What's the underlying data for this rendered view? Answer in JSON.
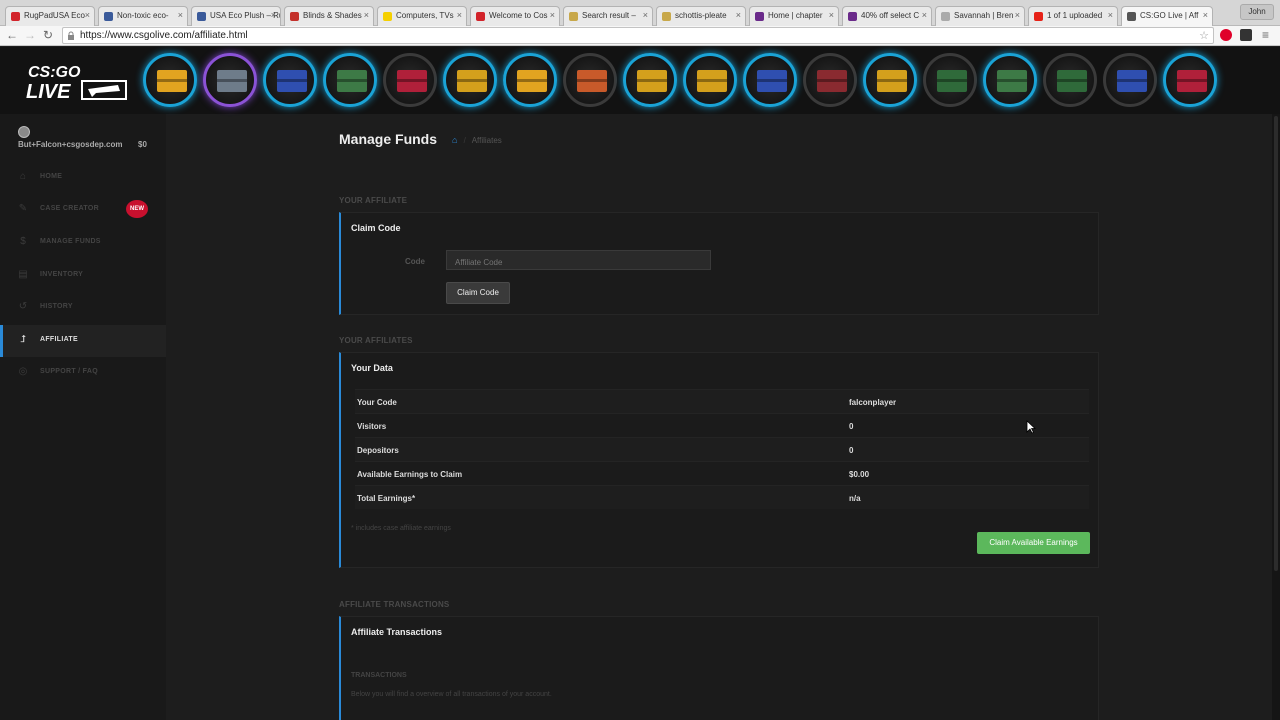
{
  "browser": {
    "tabs": [
      {
        "label": "RugPadUSA Eco",
        "color": "#d2232a"
      },
      {
        "label": "Non-toxic eco-",
        "color": "#3a5a9a"
      },
      {
        "label": "USA Eco Plush – Rug",
        "color": "#3a5a9a"
      },
      {
        "label": "Blinds & Shades",
        "color": "#c4312b"
      },
      {
        "label": "Computers, TVs",
        "color": "#f5d000"
      },
      {
        "label": "Welcome to Cos",
        "color": "#d2232a"
      },
      {
        "label": "Search result – ",
        "color": "#c8a84a"
      },
      {
        "label": "schottis-pleate",
        "color": "#c8a84a"
      },
      {
        "label": "Home | chapter",
        "color": "#6a2a8a"
      },
      {
        "label": "40% off select C",
        "color": "#6a2a8a"
      },
      {
        "label": "Savannah | Bren",
        "color": "#aaaaaa"
      },
      {
        "label": "1 of 1 uploaded",
        "color": "#e62117"
      },
      {
        "label": "CS:GO Live | Aff",
        "color": "#555555"
      }
    ],
    "profile": "John",
    "url": "https://www.csgolive.com/affiliate.html"
  },
  "header": {
    "logo_line1": "CS:GO",
    "logo_line2": "LIVE",
    "cases": [
      {
        "ring": "blue",
        "color": "#e2a420"
      },
      {
        "ring": "purple",
        "color": "#6e7c8a"
      },
      {
        "ring": "blue",
        "color": "#2f4fb0"
      },
      {
        "ring": "blue",
        "color": "#3d7a46"
      },
      {
        "ring": "dim",
        "color": "#b0203a"
      },
      {
        "ring": "blue",
        "color": "#d4a01c"
      },
      {
        "ring": "blue",
        "color": "#e2a420"
      },
      {
        "ring": "dim",
        "color": "#c85a2a"
      },
      {
        "ring": "blue",
        "color": "#d4a01c"
      },
      {
        "ring": "blue",
        "color": "#d4a01c"
      },
      {
        "ring": "blue",
        "color": "#2f4fb0"
      },
      {
        "ring": "dim",
        "color": "#8a2a30"
      },
      {
        "ring": "blue",
        "color": "#d4a01c"
      },
      {
        "ring": "dim",
        "color": "#2f6a3a"
      },
      {
        "ring": "blue",
        "color": "#3d7a46"
      },
      {
        "ring": "dim",
        "color": "#2f6a3a"
      },
      {
        "ring": "dim",
        "color": "#2f4fb0"
      },
      {
        "ring": "blue",
        "color": "#b0203a"
      }
    ]
  },
  "sidebar": {
    "username": "But+Falcon+csgosdep.com",
    "balance": "$0",
    "items": [
      {
        "label": "HOME",
        "icon": "home-icon",
        "glyph": "⌂"
      },
      {
        "label": "CASE CREATOR",
        "icon": "edit-icon",
        "glyph": "✎"
      },
      {
        "label": "MANAGE FUNDS",
        "icon": "dollar-icon",
        "glyph": "$"
      },
      {
        "label": "INVENTORY",
        "icon": "inventory-icon",
        "glyph": "▤"
      },
      {
        "label": "HISTORY",
        "icon": "history-icon",
        "glyph": "↺"
      },
      {
        "label": "AFFILIATE",
        "icon": "affiliate-icon",
        "glyph": "⮥"
      },
      {
        "label": "SUPPORT / FAQ",
        "icon": "support-icon",
        "glyph": "◎"
      }
    ],
    "new_badge": "NEW"
  },
  "main": {
    "title": "Manage Funds",
    "breadcrumb_sep": "/",
    "breadcrumb": "Affiliates",
    "your_affiliate": {
      "section": "YOUR AFFILIATE",
      "panel_title": "Claim Code",
      "code_label": "Code",
      "code_placeholder": "Affiliate Code",
      "claim_button": "Claim Code"
    },
    "your_affiliates": {
      "section": "YOUR AFFILIATES",
      "panel_title": "Your Data",
      "rows": [
        {
          "key": "Your Code",
          "value": "falconplayer"
        },
        {
          "key": "Visitors",
          "value": "0"
        },
        {
          "key": "Depositors",
          "value": "0"
        },
        {
          "key": "Available Earnings to Claim",
          "value": "$0.00"
        },
        {
          "key": "Total Earnings*",
          "value": "n/a"
        }
      ],
      "note": "* includes case affiliate earnings",
      "claim_earnings_button": "Claim Available Earnings"
    },
    "transactions": {
      "section": "AFFILIATE TRANSACTIONS",
      "panel_title": "Affiliate Transactions",
      "subhead": "TRANSACTIONS",
      "subtext": "Below you will find a overview of all transactions of your account."
    }
  },
  "colors": {
    "accent": "#2a8ad8",
    "success": "#5cb85c",
    "badge": "#c8102e"
  }
}
